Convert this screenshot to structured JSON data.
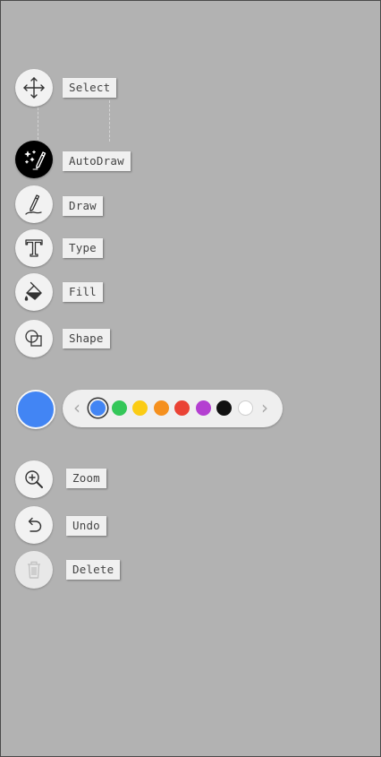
{
  "tools": {
    "select": {
      "label": "Select",
      "icon": "move-arrows-icon"
    },
    "autodraw": {
      "label": "AutoDraw",
      "icon": "magic-pen-icon"
    },
    "draw": {
      "label": "Draw",
      "icon": "pencil-icon"
    },
    "type": {
      "label": "Type",
      "icon": "text-t-icon"
    },
    "fill": {
      "label": "Fill",
      "icon": "paint-bucket-icon"
    },
    "shape": {
      "label": "Shape",
      "icon": "shapes-icon"
    },
    "zoom": {
      "label": "Zoom",
      "icon": "zoom-in-icon"
    },
    "undo": {
      "label": "Undo",
      "icon": "undo-icon"
    },
    "delete": {
      "label": "Delete",
      "icon": "trash-icon"
    }
  },
  "color_picker": {
    "current_color": "#4285f4",
    "prev_arrow": "‹",
    "next_arrow": "›",
    "selected_index": 0,
    "swatches": [
      "#4285f4",
      "#34c759",
      "#fbcc14",
      "#f5901e",
      "#ea4335",
      "#b43fd1",
      "#111111",
      "#ffffff"
    ]
  }
}
